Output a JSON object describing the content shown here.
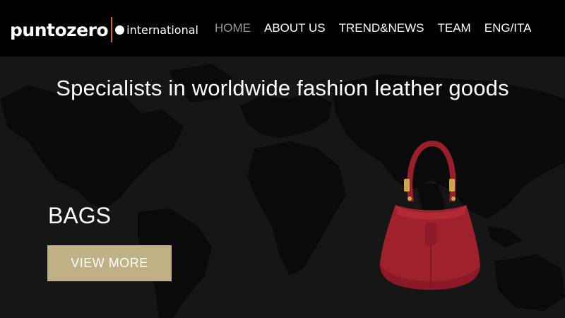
{
  "header": {
    "logo_main": "puntozero",
    "logo_sub": "international",
    "nav": [
      {
        "label": "HOME",
        "active": true
      },
      {
        "label": "ABOUT US"
      },
      {
        "label": "TREND&NEWS"
      },
      {
        "label": "TEAM"
      },
      {
        "label": "ENG/ITA"
      }
    ]
  },
  "hero": {
    "headline": "Specialists in worldwide fashion leather goods",
    "section_title": "BAGS",
    "cta_label": "VIEW MORE",
    "product_image": "red-suede-bucket-bag"
  },
  "colors": {
    "accent_gold": "#bfb085",
    "logo_divider": "#e05a2b",
    "nav_active": "#9a9a9a",
    "bag_red": "#a0212e"
  }
}
